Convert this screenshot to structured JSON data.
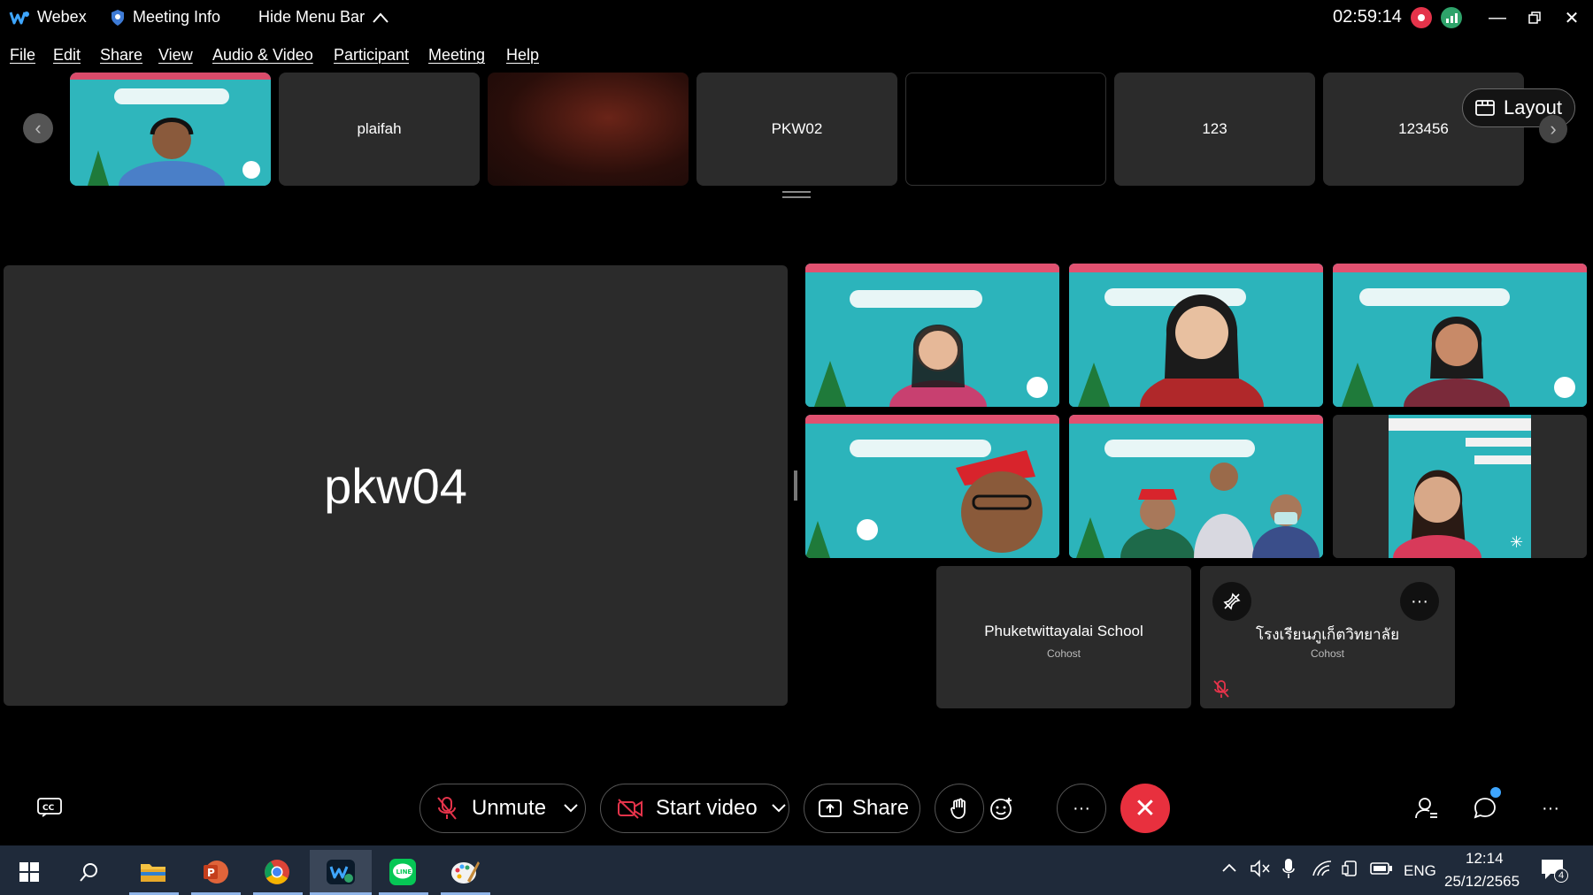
{
  "titlebar": {
    "app_name": "Webex",
    "meeting_info": "Meeting Info",
    "hide_menu": "Hide Menu Bar",
    "timer": "02:59:14"
  },
  "menu": [
    "File",
    "Edit",
    "Share",
    "View",
    "Audio & Video",
    "Participant",
    "Meeting",
    "Help"
  ],
  "filmstrip": {
    "tiles": [
      "",
      "plaifah",
      "",
      "PKW02",
      "",
      "123",
      "123456"
    ],
    "layout_label": "Layout"
  },
  "stage": {
    "active_name": "pkw04",
    "participants": [
      {
        "name": "Phuketwittayalai School",
        "role": "Cohost"
      },
      {
        "name": "โรงเรียนภูเก็ตวิทยาลัย",
        "role": "Cohost"
      }
    ]
  },
  "controls": {
    "unmute": "Unmute",
    "start_video": "Start video",
    "share": "Share"
  },
  "taskbar": {
    "language": "ENG",
    "time": "12:14",
    "date": "25/12/2565",
    "notifications": "4"
  },
  "colors": {
    "background": "#000000",
    "tile": "#2b2b2b",
    "end_call": "#e8303e",
    "recording": "#e4334a",
    "taskbar": "#1f2a3a"
  }
}
